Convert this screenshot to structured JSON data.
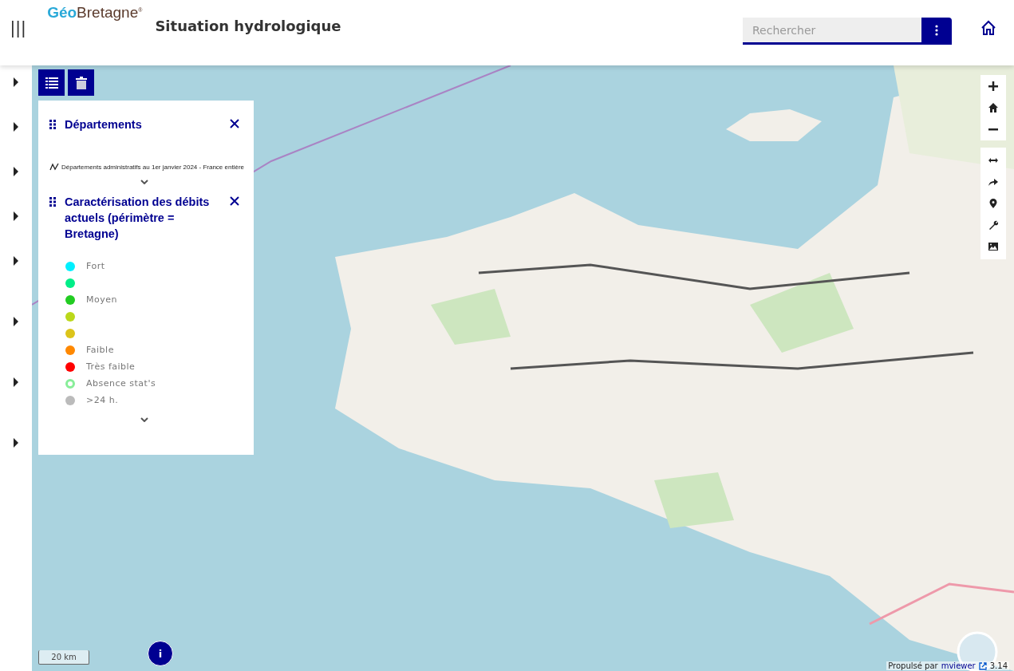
{
  "header": {
    "logo": {
      "part_1": "Géo",
      "part_2": "Bretagne",
      "mark": "®"
    },
    "menu_glyph": "|||",
    "title": "Situation hydrologique",
    "search": {
      "placeholder": "Rechercher"
    }
  },
  "sidebar": {
    "items": [
      {
        "expanded": false
      },
      {
        "expanded": false
      },
      {
        "expanded": false
      },
      {
        "expanded": false
      },
      {
        "expanded": false
      },
      {
        "expanded": false
      },
      {
        "expanded": false
      },
      {
        "expanded": false
      }
    ]
  },
  "legend_panel": {
    "layers": [
      {
        "title": "Départements",
        "subtitle": "Départements administratifs au 1er janvier 2024 - France entière"
      },
      {
        "title": "Caractérisation des débits actuels (périmètre = Bretagne)",
        "classes": [
          {
            "kind": "dot",
            "color": "#00f0ff",
            "label": "Fort"
          },
          {
            "kind": "dot",
            "color": "#00ee88"
          },
          {
            "kind": "dot",
            "color": "#22cc22",
            "label": "Moyen"
          },
          {
            "kind": "dot",
            "color": "#bbd81a"
          },
          {
            "kind": "dot",
            "color": "#dcc41a"
          },
          {
            "kind": "dot",
            "color": "#ff8800",
            "label": "Faible"
          },
          {
            "kind": "dot",
            "color": "#ff0000",
            "label": "Très faible"
          },
          {
            "kind": "ring",
            "color": "#88ee99",
            "label": "Absence stat's"
          },
          {
            "kind": "dot",
            "color": "#bbbbbb",
            "label": ">24 h."
          }
        ]
      }
    ]
  },
  "map": {
    "kind": "picture",
    "scale": "20 km",
    "info": "i",
    "attribution": {
      "prefix": "Propulsé par",
      "link": "mviewer",
      "version": "3.14"
    }
  }
}
